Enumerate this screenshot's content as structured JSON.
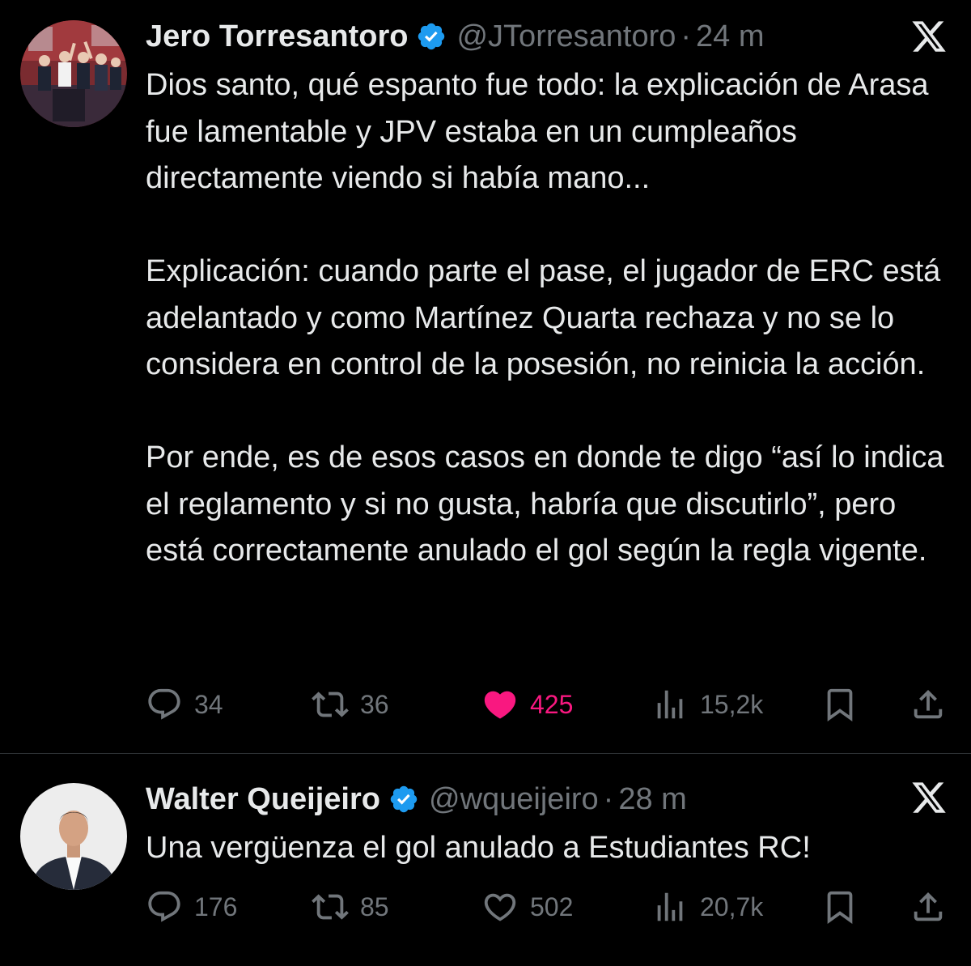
{
  "tweets": [
    {
      "name": "Jero Torresantoro",
      "handle": "@JTorresantoro",
      "separator": "·",
      "time": "24 m",
      "paragraphs": [
        "Dios santo, qué espanto fue todo: la explicación de Arasa fue lamentable y JPV estaba en un cumpleaños directamente viendo si había mano...",
        "Explicación: cuando parte el pase, el jugador de ERC está adelantado y como Martínez Quarta rechaza y no se lo considera en control de la posesión, no reinicia la acción.",
        "Por ende, es de esos casos en donde te digo “así lo indica el reglamento y si no gusta, habría que discutirlo”, pero está correctamente anulado el gol según la regla vigente."
      ],
      "metrics": {
        "replies": "34",
        "reposts": "36",
        "likes": "425",
        "views": "15,2k"
      },
      "liked": true,
      "icons": [
        "reply-icon",
        "repost-icon",
        "heart-filled-icon",
        "views-icon",
        "bookmark-icon",
        "share-icon"
      ]
    },
    {
      "name": "Walter Queijeiro",
      "handle": "@wqueijeiro",
      "separator": "·",
      "time": "28 m",
      "paragraphs": [
        "Una vergüenza el gol anulado a Estudiantes RC!"
      ],
      "metrics": {
        "replies": "176",
        "reposts": "85",
        "likes": "502",
        "views": "20,7k"
      },
      "liked": false,
      "icons": [
        "reply-icon",
        "repost-icon",
        "heart-outline-icon",
        "views-icon",
        "bookmark-icon",
        "share-icon"
      ]
    }
  ],
  "colors": {
    "background": "#000000",
    "text": "#e7e9ea",
    "muted": "#71767b",
    "verified": "#1d9bf0",
    "like": "#f91880",
    "divider": "#2f3336"
  }
}
